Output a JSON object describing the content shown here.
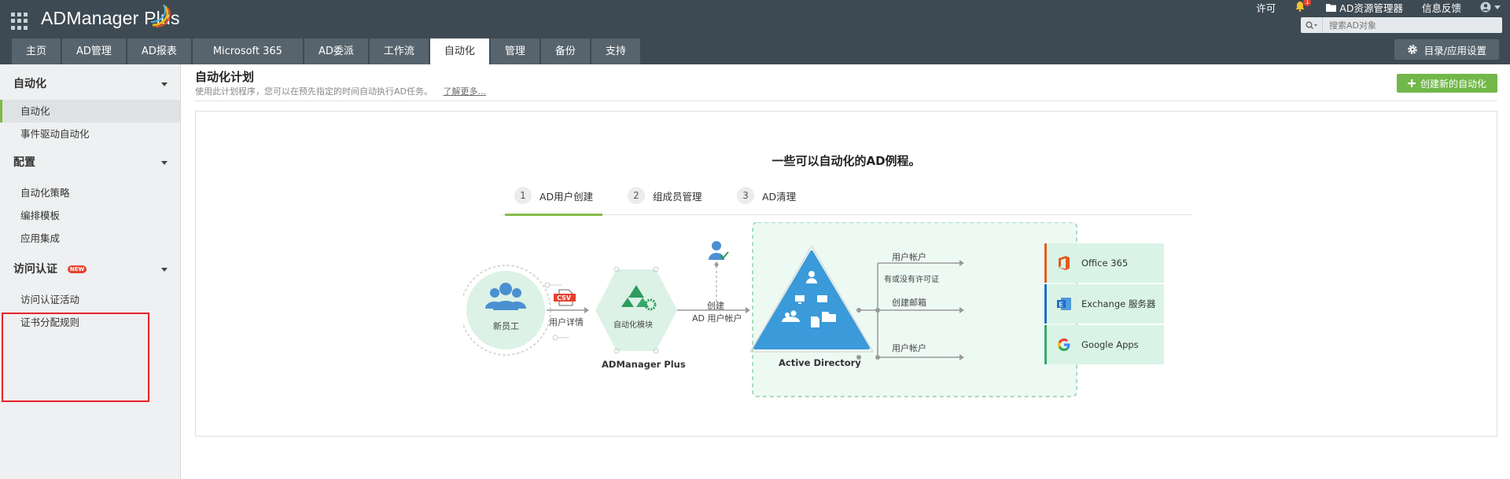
{
  "header": {
    "brand": "ADManager Plus",
    "links": {
      "license": "许可",
      "notification_count": "1",
      "ad_explorer": "AD资源管理器",
      "feedback": "信息反馈"
    },
    "search": {
      "placeholder": "搜索AD对象"
    },
    "nav_tabs": [
      "主页",
      "AD管理",
      "AD报表",
      "Microsoft 365",
      "AD委派",
      "工作流",
      "自动化",
      "管理",
      "备份",
      "支持"
    ],
    "active_tab": "自动化",
    "settings_button": "目录/应用设置"
  },
  "sidebar": {
    "sections": [
      {
        "title": "自动化",
        "items": [
          "自动化",
          "事件驱动自动化"
        ],
        "active_item": "自动化"
      },
      {
        "title": "配置",
        "items": [
          "自动化策略",
          "编排模板",
          "应用集成"
        ]
      },
      {
        "title": "访问认证",
        "badge": "NEW",
        "items": [
          "访问认证活动",
          "证书分配规则"
        ]
      }
    ]
  },
  "main": {
    "title": "自动化计划",
    "description": "使用此计划程序，您可以在预先指定的时间自动执行AD任务。",
    "learn_more": "了解更多...",
    "create_button": "创建新的自动化",
    "example_title": "一些可以自动化的AD例程。",
    "steps": [
      {
        "num": "1",
        "label": "AD用户创建"
      },
      {
        "num": "2",
        "label": "组成员管理"
      },
      {
        "num": "3",
        "label": "AD清理"
      }
    ],
    "active_step": "1"
  },
  "diagram": {
    "new_employee": "新员工",
    "csv_label": "CSV",
    "user_details": "用户详情",
    "automation_module": "自动化模块",
    "admanager": "ADManager Plus",
    "create_line1": "创建",
    "create_line2": "AD 用户帐户",
    "active_directory": "Active Directory",
    "branch1": "用户帐户",
    "branch1_sub": "有或没有许可证",
    "branch2": "创建邮箱",
    "branch3": "用户帐户",
    "services": [
      "Office 365",
      "Exchange 服务器",
      "Google Apps"
    ],
    "colors": {
      "accent": "#86bd4a",
      "ad_blue": "#3b9ad9",
      "panel_green": "#edfaf3",
      "team_blue": "#4a90d1"
    }
  }
}
